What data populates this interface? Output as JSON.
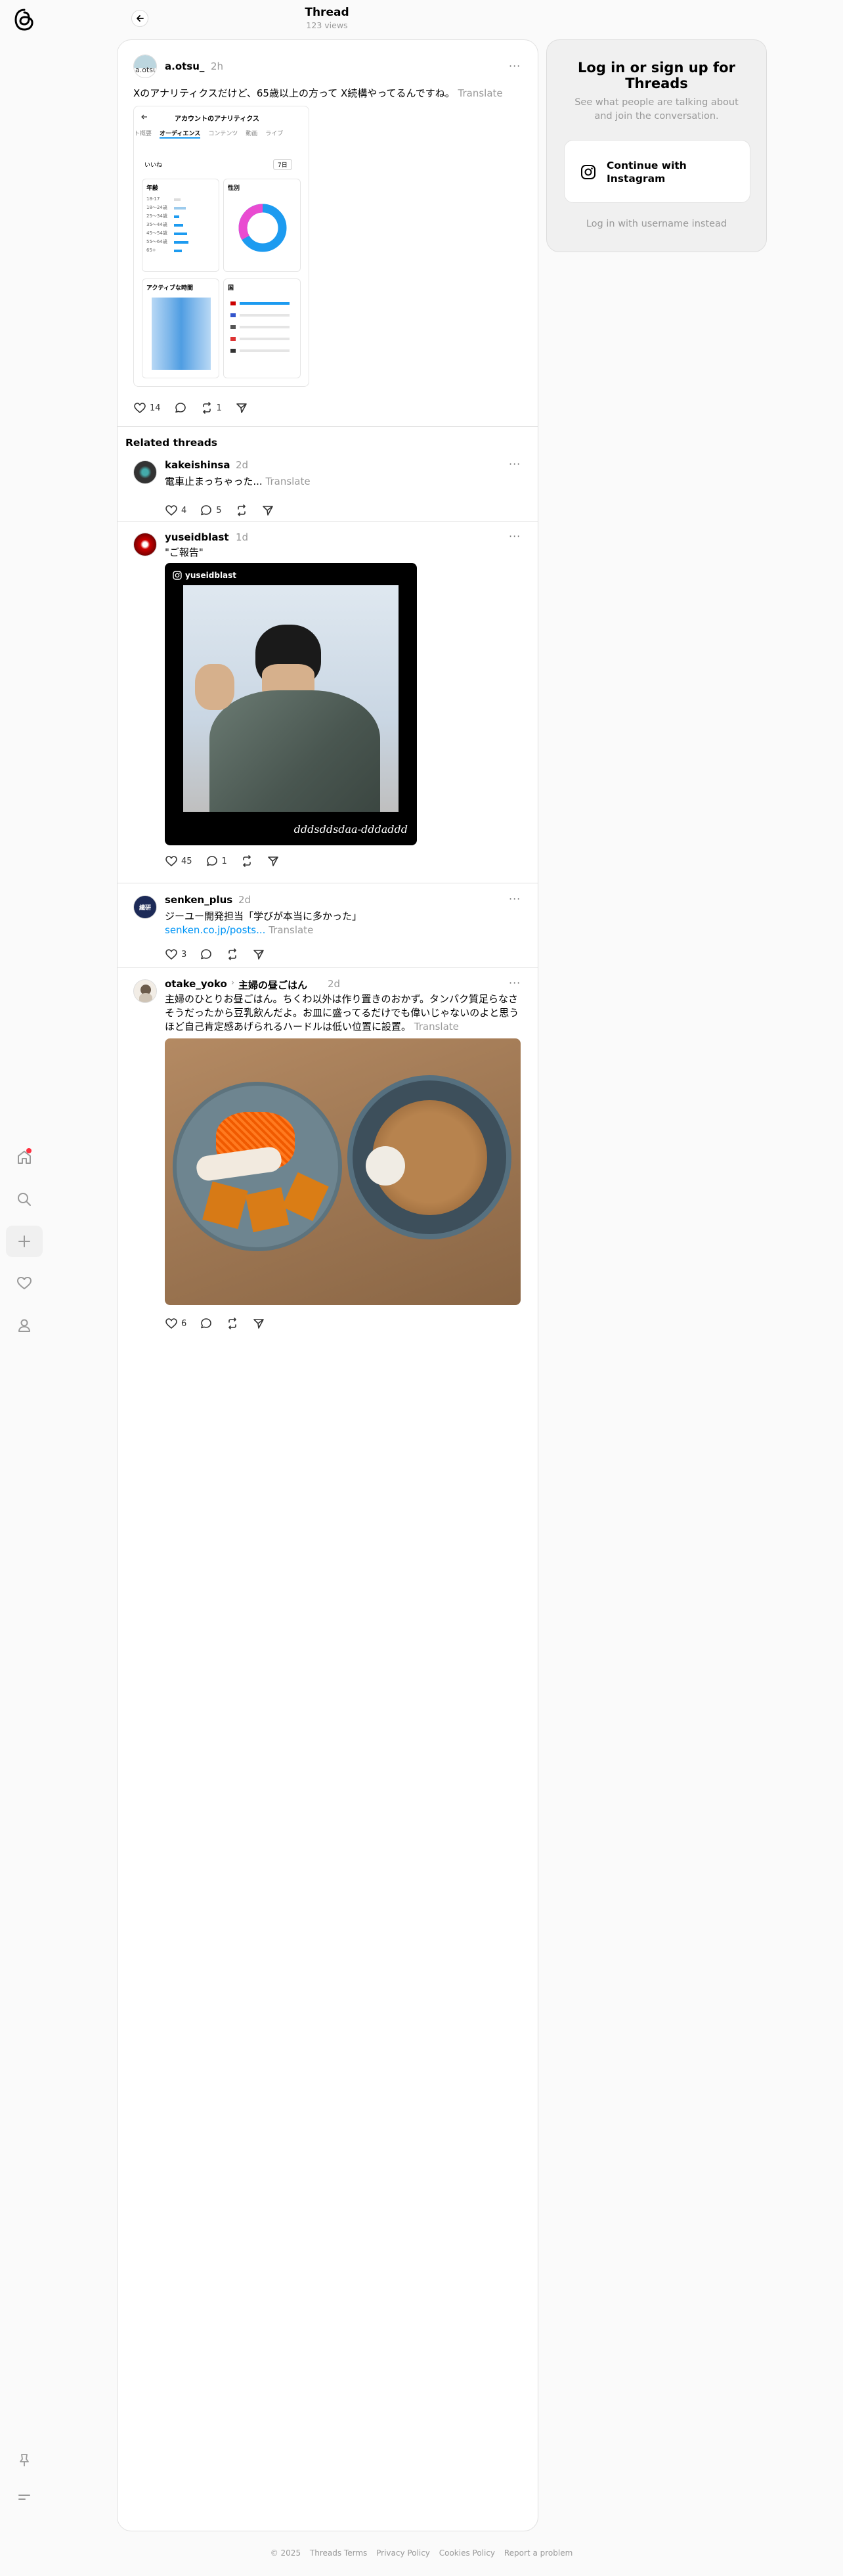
{
  "header": {
    "title": "Thread",
    "views": "123 views"
  },
  "nav": {
    "items": [
      {
        "icon": "home-icon"
      },
      {
        "icon": "search-icon"
      },
      {
        "icon": "create-icon"
      },
      {
        "icon": "heart-icon"
      },
      {
        "icon": "profile-icon"
      }
    ],
    "bottom": [
      {
        "icon": "pin-icon"
      },
      {
        "icon": "menu-icon"
      }
    ]
  },
  "main_post": {
    "username": "a.otsu_",
    "avatar_text": "a.otsu",
    "time": "2h",
    "text": "Xのアナリティクスだけど、65歳以上の方って X続構やってるんですね。",
    "translate": "Translate",
    "likes": "14",
    "reposts": "1",
    "screenshot": {
      "title": "アカウントのアナリティクス",
      "tabs": [
        "ト概要",
        "オーディエンス",
        "コンテンツ",
        "動画",
        "ライブ"
      ],
      "filter": "いいね",
      "range": "7日",
      "age_card": "年齢",
      "age_rows": [
        "18-17",
        "18〜24歳",
        "25〜34歳",
        "35〜44歳",
        "45〜54歳",
        "55〜64歳",
        "65+"
      ],
      "gender_card": "性別",
      "active_card": "アクティブな時間",
      "country_card": "国"
    }
  },
  "related_heading": "Related threads",
  "related": [
    {
      "username": "kakeishinsa",
      "time": "2d",
      "text": "電車止まっちゃった...",
      "translate": "Translate",
      "likes": "4",
      "replies": "5"
    },
    {
      "username": "yuseidblast",
      "time": "1d",
      "text": "\"ご報告\"",
      "photo_handle": "yuseidblast",
      "photo_sig": "dddsddsdaa-dddaddd",
      "likes": "45",
      "replies": "1"
    },
    {
      "username": "senken_plus",
      "avatar_text": "繊研",
      "time": "2d",
      "text": "ジーユー開発担当「学びが本当に多かった」",
      "link": "senken.co.jp/posts...",
      "translate": "Translate",
      "likes": "3"
    },
    {
      "username": "otake_yoko",
      "topic": "主婦の昼ごはん",
      "time": "2d",
      "text": "主婦のひとりお昼ごはん。ちくわ以外は作り置きのおかず。タンパク質足らなさそうだったから豆乳飲んだよ。お皿に盛ってるだけでも偉いじゃないのよと思うほど自己肯定感あげられるハードルは低い位置に設置。",
      "translate": "Translate",
      "likes": "6"
    }
  ],
  "login": {
    "title": "Log in or sign up for Threads",
    "subtitle": "See what people are talking about and join the conversation.",
    "button": "Continue with Instagram",
    "alt": "Log in with username instead"
  },
  "footer": {
    "links": [
      "© 2025",
      "Threads Terms",
      "Privacy Policy",
      "Cookies Policy",
      "Report a problem"
    ]
  }
}
